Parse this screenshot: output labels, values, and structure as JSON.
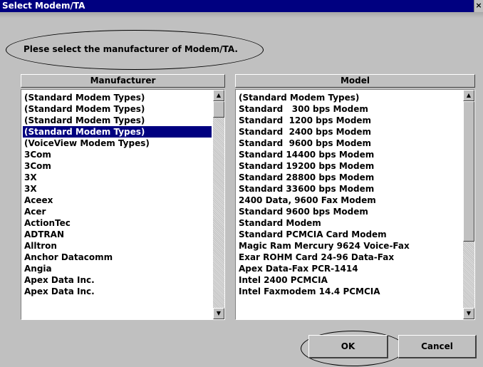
{
  "window": {
    "title": "Select Modem/TA",
    "close_glyph": "×"
  },
  "prompt": "Plese select the manufacturer of Modem/TA.",
  "manufacturer": {
    "header": "Manufacturer",
    "items": [
      "(Standard Modem Types)",
      "(Standard Modem Types)",
      "(Standard Modem Types)",
      "(Standard Modem Types)",
      "(VoiceView Modem Types)",
      "3Com",
      "3Com",
      "3X",
      "3X",
      "Aceex",
      "Acer",
      "ActionTec",
      "ADTRAN",
      "Alltron",
      "Anchor Datacomm",
      "Angia",
      "Apex Data Inc.",
      "Apex Data Inc."
    ],
    "selected_index": 3
  },
  "model": {
    "header": "Model",
    "items": [
      "(Standard Modem Types)",
      "Standard   300 bps Modem",
      "Standard  1200 bps Modem",
      "Standard  2400 bps Modem",
      "Standard  9600 bps Modem",
      "Standard 14400 bps Modem",
      "Standard 19200 bps Modem",
      "Standard 28800 bps Modem",
      "Standard 33600 bps Modem",
      "2400 Data, 9600 Fax Modem",
      "Standard 9600 bps Modem",
      "Standard Modem",
      "Standard PCMCIA Card Modem",
      "Magic Ram Mercury 9624 Voice-Fax",
      "Exar ROHM Card 24-96 Data-Fax",
      "Apex Data-Fax PCR-1414",
      "Intel 2400 PCMCIA",
      "Intel Faxmodem 14.4 PCMCIA"
    ]
  },
  "buttons": {
    "ok": "OK",
    "cancel": "Cancel"
  },
  "icons": {
    "scroll_up": "up-arrow-icon",
    "scroll_down": "down-arrow-icon",
    "close": "close-icon"
  }
}
